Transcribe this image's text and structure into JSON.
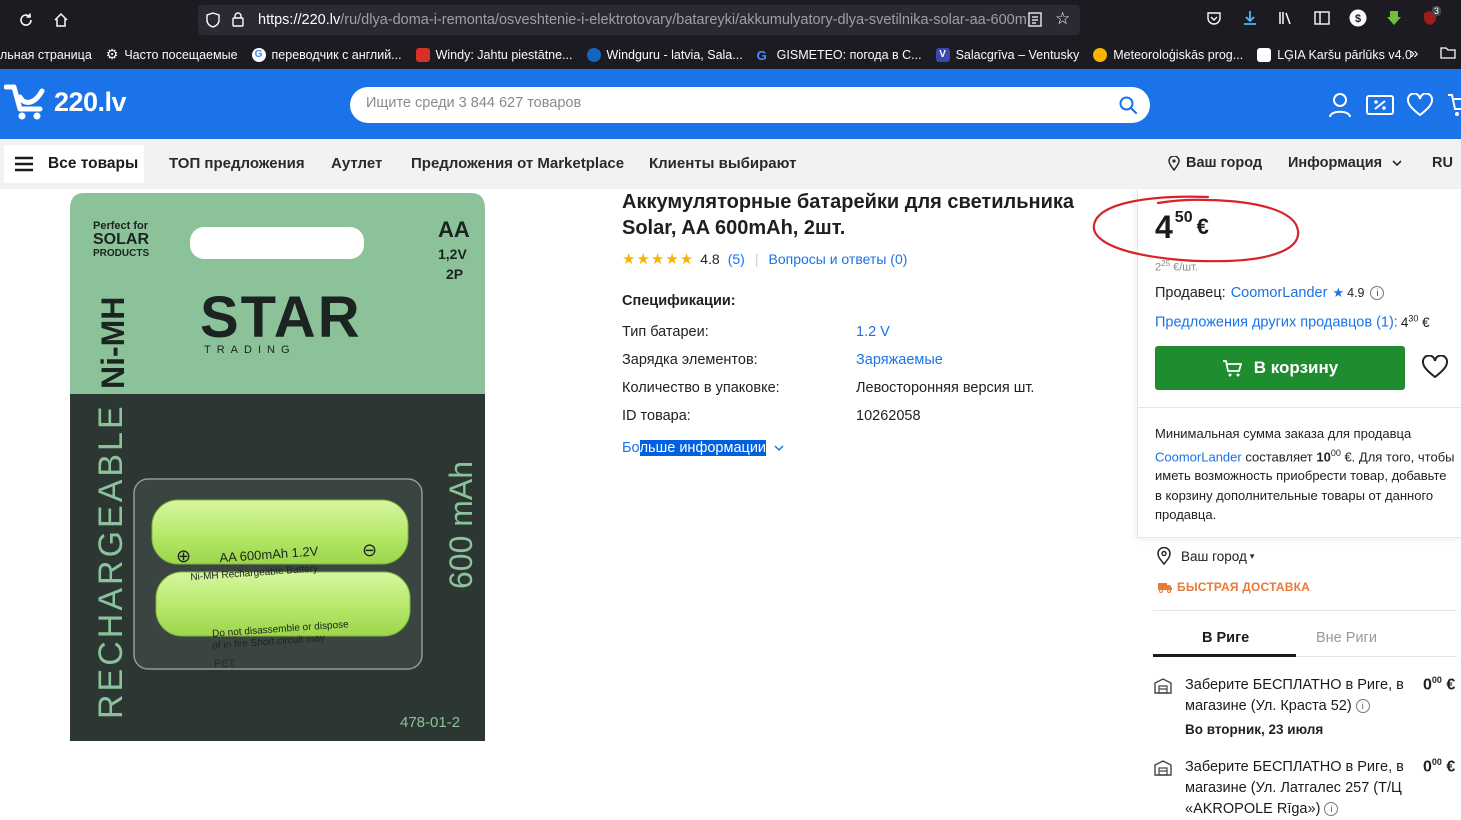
{
  "browser": {
    "url_main": "https://220.lv",
    "url_path": "/ru/dlya-doma-i-remonta/osveshtenie-i-elektrotovary/batareyki/akkumulyatory-dlya-svetilnika-solar-aa-600m",
    "download_count": "3",
    "bookmarks": [
      {
        "label": "льная страница",
        "color": ""
      },
      {
        "label": "Часто посещаемые",
        "color": "#bbbbbb"
      },
      {
        "label": "переводчик с англий...",
        "color": "#4285f4"
      },
      {
        "label": "Windy: Jahtu piestātne...",
        "color": "#d93025"
      },
      {
        "label": "Windguru - latvia, Sala...",
        "color": "#1565c0"
      },
      {
        "label": "GISMETEO: погода в С...",
        "color": "#2a6fd6"
      },
      {
        "label": "Salacgrīva – Ventusky",
        "color": "#3949ab"
      },
      {
        "label": "Meteoroloģiskās prog...",
        "color": "#f6b400"
      },
      {
        "label": "LĢIA Karšu pārlūks v4.0",
        "color": "#ffffff"
      }
    ]
  },
  "header": {
    "logo_text": "220.lv",
    "search_placeholder": "Ищите среди 3 844 627 товаров"
  },
  "nav": {
    "all_goods": "Все товары",
    "links": [
      "ТОП предложения",
      "Аутлет",
      "Предложения от Marketplace",
      "Клиенты выбирают"
    ],
    "city": "Ваш город",
    "info": "Информация",
    "lang": "RU"
  },
  "product": {
    "title": "Аккумуляторные батарейки для светильника Solar, AA 600mAh, 2шт.",
    "rating": "4.8",
    "reviews": "(5)",
    "qa": "Вопросы и ответы (0)",
    "specs_title": "Спецификации:",
    "specs": [
      {
        "key": "Тип батареи:",
        "value": "1.2 V",
        "link": true
      },
      {
        "key": "Зарядка элементов:",
        "value": "Заряжаемые",
        "link": true
      },
      {
        "key": "Количество в упаковке:",
        "value": "Левосторонняя версия шт.",
        "link": false
      },
      {
        "key": "ID товара:",
        "value": "10262058",
        "link": false
      }
    ],
    "more_info_a": "Бо",
    "more_info_b": "льше информации",
    "image": {
      "brand": "STAR",
      "brand_sub": "TRADING",
      "perfect_for": "Perfect for",
      "solar": "SOLAR",
      "products": "PRODUCTS",
      "size": "AA",
      "voltage": "1,2V",
      "count": "2P",
      "chem": "Ni-MH",
      "rechargeable": "RECHARGEABLE",
      "capacity": "600 mAh",
      "battery_label": "AA  600mAh 1.2V",
      "battery_sub": "Ni-MH Rechargeable Battery",
      "battery_warn": "Do not disassemble or dispose",
      "battery_warn2": "of in fire Short circuit may",
      "code": "478-01-2",
      "pet": "PET"
    }
  },
  "buybox": {
    "price_int": "4",
    "price_cents": "50",
    "currency": "€",
    "unit_int": "2",
    "unit_cents": "25",
    "unit_suffix": "€/шт.",
    "seller_label": "Продавец:",
    "seller_name": "CoomorLander",
    "seller_rating": "4.9",
    "other_offers": "Предложения других продавцов (1):",
    "other_int": "4",
    "other_cents": "30",
    "other_cur": "€",
    "cart_label": "В корзину",
    "min_order_1": "Минимальная сумма заказа для продавца",
    "min_order_seller": "CoomorLander",
    "min_order_2": " составляет ",
    "min_order_amount": "10",
    "min_order_amount_cents": "00",
    "min_order_3": " €. Для того, чтобы иметь возможность приобрести товар, добавьте в корзину дополнительные товары от данного продавца."
  },
  "delivery": {
    "city": "Ваш город",
    "fast": "БЫСТРАЯ ДОСТАВКА",
    "tab_riga": "В Риге",
    "tab_outside": "Вне Риги",
    "pickups": [
      {
        "text": "Заберите БЕСПЛАТНО в Риге, в магазине (Ул. Краста 52)",
        "int": "0",
        "cents": "00",
        "cur": "€",
        "date": "Во вторник, 23 июля"
      },
      {
        "text": "Заберите БЕСПЛАТНО в Риге, в магазине (Ул. Латгалес 257 (Т/Ц «AKROPOLE Rīga»)",
        "int": "0",
        "cents": "00",
        "cur": "€",
        "date": ""
      }
    ]
  },
  "colors": {
    "brand_blue": "#1a73e8",
    "cart_green": "#1e8c2f",
    "annotation_red": "#d8232a",
    "fast_orange": "#e87a3a"
  }
}
